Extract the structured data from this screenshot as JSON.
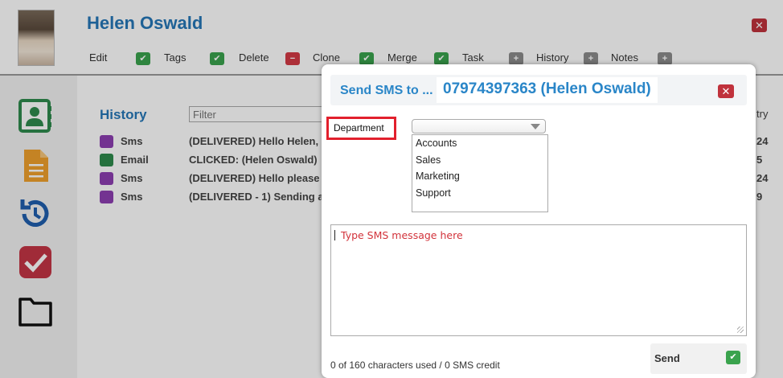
{
  "contact": {
    "name": "Helen Oswald"
  },
  "actions": [
    {
      "label": "Edit",
      "icon": "check-icon",
      "color": "#3aa34d"
    },
    {
      "label": "Tags",
      "icon": "check-icon",
      "color": "#3aa34d"
    },
    {
      "label": "Delete",
      "icon": "minus-icon",
      "color": "#d33a45"
    },
    {
      "label": "Clone",
      "icon": "check-icon",
      "color": "#3aa34d"
    },
    {
      "label": "Merge",
      "icon": "check-icon",
      "color": "#3aa34d"
    },
    {
      "label": "Task",
      "icon": "plus-icon",
      "color": "#8c8c8c"
    },
    {
      "label": "History",
      "icon": "plus-icon",
      "color": "#8c8c8c"
    },
    {
      "label": "Notes",
      "icon": "plus-icon",
      "color": "#8c8c8c"
    }
  ],
  "sidebar": {
    "icons": [
      "contact-card-icon",
      "document-icon",
      "history-icon",
      "task-check-icon",
      "folder-icon"
    ]
  },
  "history": {
    "title": "History",
    "filter_placeholder": "Filter",
    "rows": [
      {
        "type": "Sms",
        "badge_color": "#8d3fb1",
        "summary": "(DELIVERED) Hello Helen,",
        "right": "24"
      },
      {
        "type": "Email",
        "badge_color": "#2e8a4c",
        "summary": "CLICKED: (Helen Oswald)",
        "right": "5"
      },
      {
        "type": "Sms",
        "badge_color": "#8d3fb1",
        "summary": "(DELIVERED) Hello please",
        "right": "24"
      },
      {
        "type": "Sms",
        "badge_color": "#8d3fb1",
        "summary": "(DELIVERED - 1) Sending a",
        "right": "9"
      }
    ],
    "right_header": "try"
  },
  "modal": {
    "title": "Send SMS to ...",
    "recipient": "07974397363 (Helen Oswald)",
    "department_label": "Department",
    "department_selected": "",
    "department_options": [
      "Accounts",
      "Sales",
      "Marketing",
      "Support"
    ],
    "message_placeholder": "Type SMS message here",
    "char_count": "0 of 160 characters used / 0 SMS credit",
    "send_label": "Send"
  },
  "colors": {
    "accent_blue": "#2577b8",
    "close_red": "#c0323c",
    "highlight_red": "#e2202d",
    "send_green": "#3aa34d"
  }
}
